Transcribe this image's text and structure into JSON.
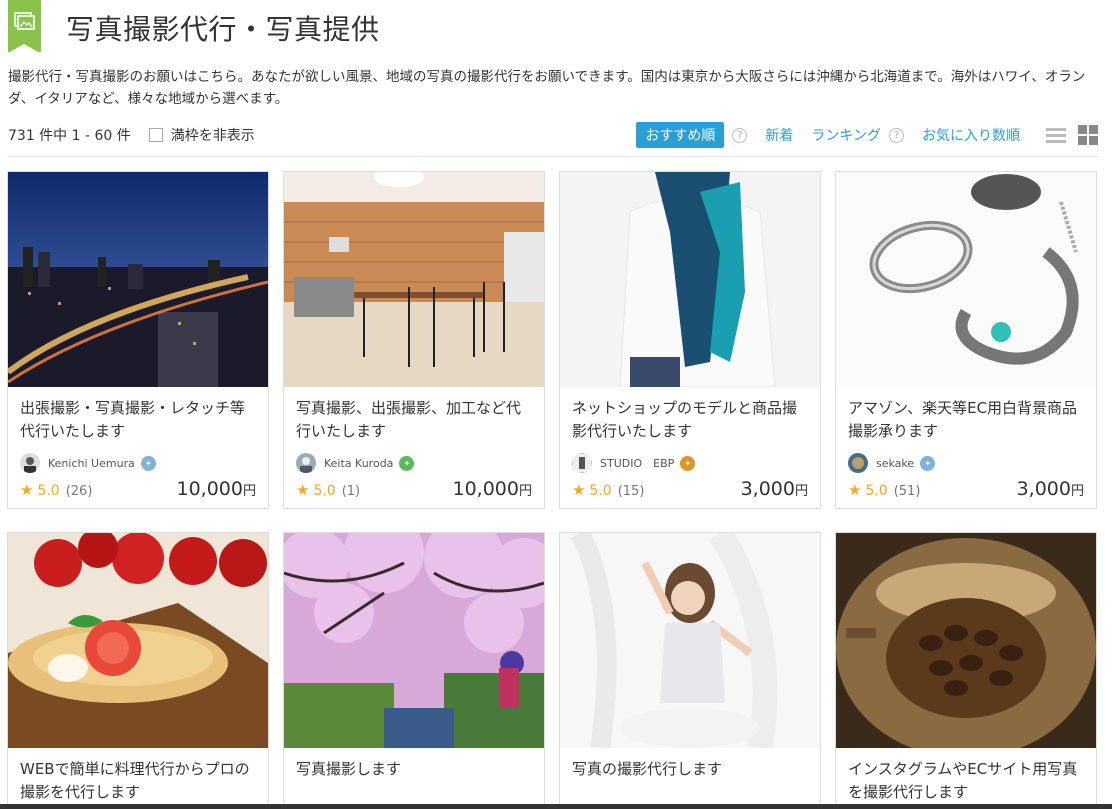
{
  "header": {
    "title": "写真撮影代行・写真提供",
    "icon": "photo-category-icon",
    "icon_color": "#8bc34a"
  },
  "description": "撮影代行・写真撮影のお願いはこちら。あなたが欲しい風景、地域の写真の撮影代行をお願いできます。国内は東京から大阪さらには沖縄から北海道まで。海外はハワイ、オランダ、イタリアなど、様々な地域から選べます。",
  "toolbar": {
    "count": "731 件中 1 - 60 件",
    "hide_full_label": "満枠を非表示",
    "sort_recommended": "おすすめ順",
    "sort_new": "新着",
    "sort_ranking": "ランキング",
    "sort_favorites": "お気に入り数順",
    "help_glyph": "?",
    "accent_color": "#2a9fd6"
  },
  "cards": [
    {
      "title": "出張撮影・写真撮影・レタッチ等代行いたします",
      "seller": "Kenichi Uemura",
      "badge": "silver",
      "rating": "5.0",
      "reviews": "(26)",
      "price": "10,000",
      "yen": "円"
    },
    {
      "title": "写真撮影、出張撮影、加工など代行いたします",
      "seller": "Keita Kuroda",
      "badge": "green",
      "rating": "5.0",
      "reviews": "(1)",
      "price": "10,000",
      "yen": "円"
    },
    {
      "title": "ネットショップのモデルと商品撮影代行いたします",
      "seller": "STUDIO　EBP",
      "badge": "bronze",
      "rating": "5.0",
      "reviews": "(15)",
      "price": "3,000",
      "yen": "円"
    },
    {
      "title": "アマゾン、楽天等EC用白背景商品撮影承ります",
      "seller": "sekake",
      "badge": "silver",
      "rating": "5.0",
      "reviews": "(51)",
      "price": "3,000",
      "yen": "円"
    },
    {
      "title": "WEBで簡単に料理代行からプロの撮影を代行します"
    },
    {
      "title": "写真撮影します"
    },
    {
      "title": "写真の撮影代行します"
    },
    {
      "title": "インスタグラムやECサイト用写真を撮影代行します"
    }
  ]
}
